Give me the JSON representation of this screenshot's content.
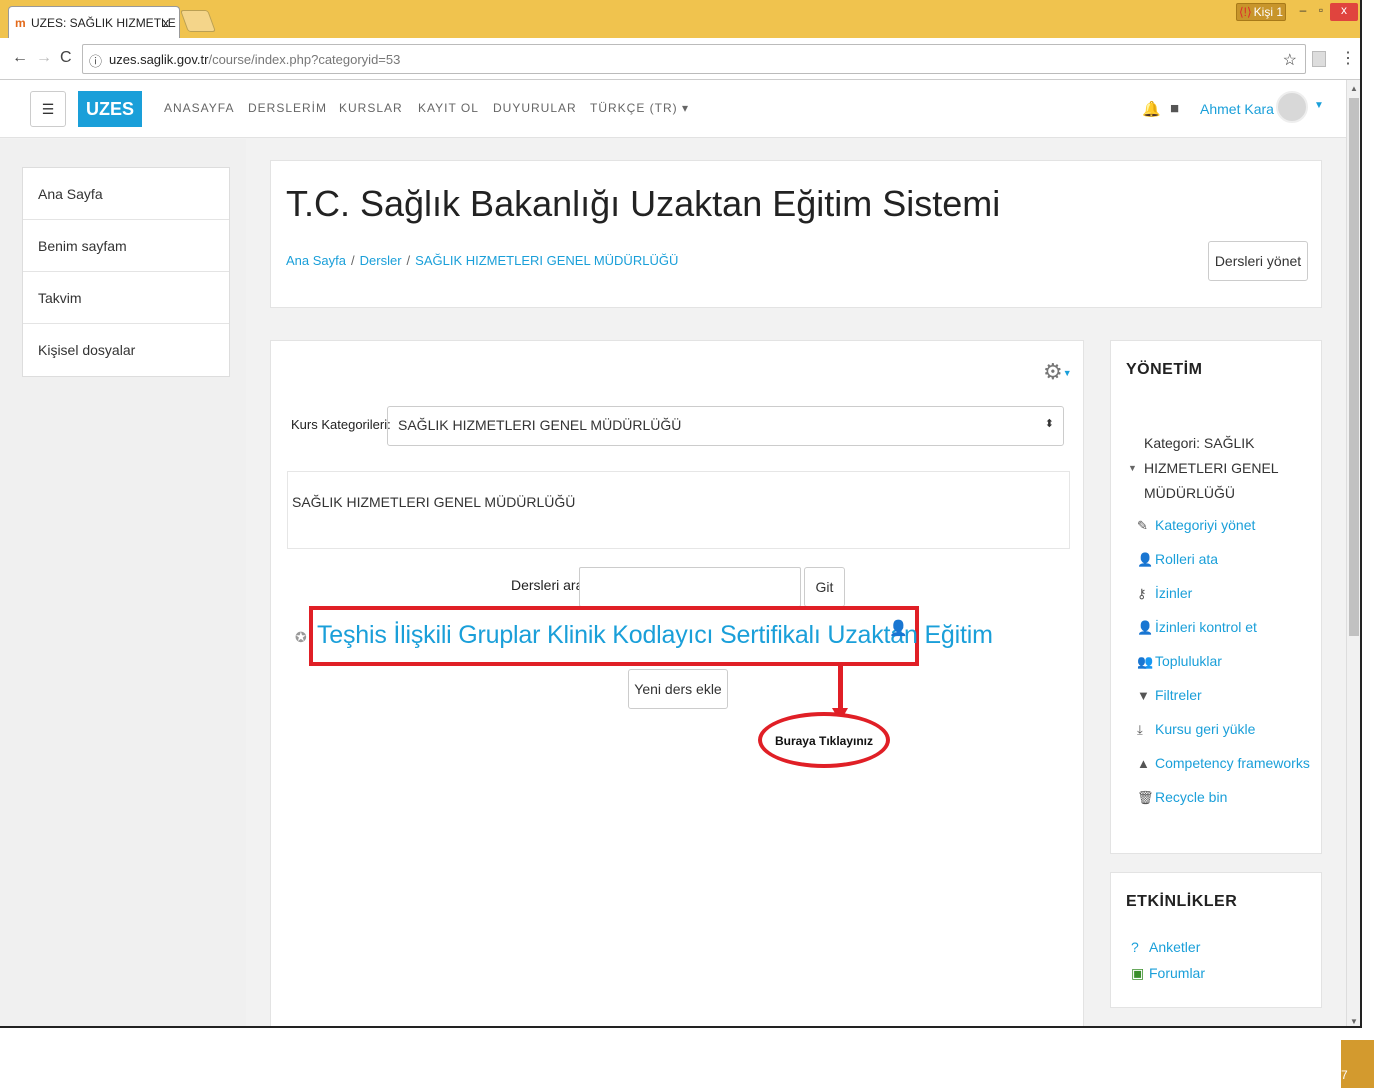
{
  "browser": {
    "tab_title": "UZES: SAĞLIK HIZMETLE",
    "tab_close": "x",
    "profile_label": "Kişi 1",
    "url_host": "uzes.saglik.gov.tr",
    "url_path": "/course/index.php?categoryid=53"
  },
  "navbar": {
    "brand": "UZES",
    "menu": [
      "ANASAYFA",
      "DERSLERİM",
      "KURSLAR",
      "KAYIT OL",
      "DUYURULAR",
      "TÜRKÇE (TR) ▾"
    ],
    "user_name": "Ahmet Kara"
  },
  "drawer": {
    "items": [
      "Ana Sayfa",
      "Benim sayfam",
      "Takvim",
      "Kişisel dosyalar"
    ]
  },
  "header": {
    "title": "T.C. Sağlık Bakanlığı Uzaktan Eğitim Sistemi",
    "breadcrumb": [
      "Ana Sayfa",
      "Dersler",
      "SAĞLIK HIZMETLERI GENEL MÜDÜRLÜĞÜ"
    ],
    "manage_button": "Dersleri yönet"
  },
  "main": {
    "category_label": "Kurs Kategorileri:",
    "category_selected": "SAĞLIK HIZMETLERI GENEL MÜDÜRLÜĞÜ",
    "category_description": "SAĞLIK HIZMETLERI GENEL MÜDÜRLÜĞÜ",
    "search_label": "Dersleri ara",
    "search_value": "",
    "search_button": "Git",
    "course_link": "Teşhis İlişkili Gruplar Klinik Kodlayıcı Sertifikalı Uzaktan Eğitim",
    "new_course_button": "Yeni ders ekle",
    "callout": "Buraya Tıklayınız"
  },
  "admin_block": {
    "title": "YÖNETİM",
    "category_node": "Kategori: SAĞLIK HIZMETLERI GENEL MÜDÜRLÜĞÜ",
    "links": [
      "Kategoriyi yönet",
      "Rolleri ata",
      "İzinler",
      "İzinleri kontrol et",
      "Topluluklar",
      "Filtreler",
      "Kursu geri yükle",
      "Competency frameworks",
      "Recycle bin"
    ]
  },
  "activities_block": {
    "title": "ETKİNLİKLER",
    "links": [
      "Anketler",
      "Forumlar"
    ]
  },
  "colors": {
    "accent": "#1a9fd9",
    "annotation": "#e01f26",
    "chrome": "#f0c34e"
  }
}
